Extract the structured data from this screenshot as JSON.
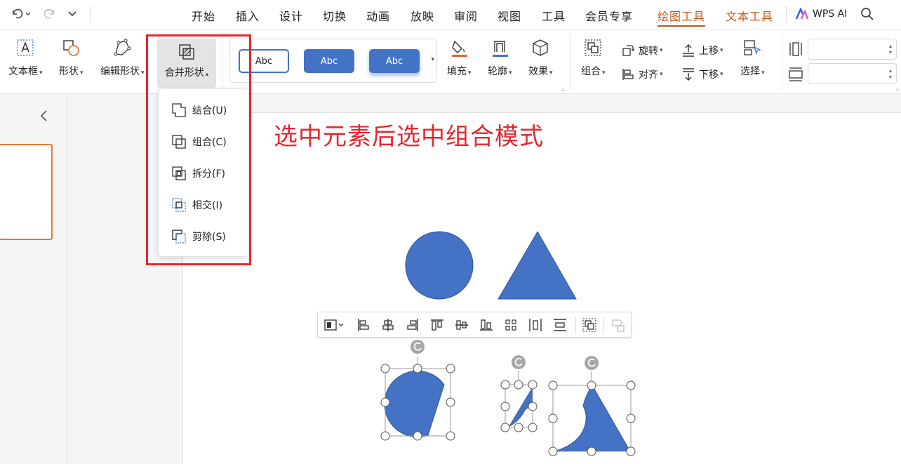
{
  "menu": {
    "items": [
      "开始",
      "插入",
      "设计",
      "切换",
      "动画",
      "放映",
      "审阅",
      "视图",
      "工具",
      "会员专享"
    ],
    "drawing_tools": "绘图工具",
    "text_tools": "文本工具",
    "ai": "WPS AI"
  },
  "ribbon": {
    "textbox": "文本框",
    "shape": "形状",
    "edit_shape": "编辑形状",
    "merge_shape": "合并形状",
    "styles": [
      "Abc",
      "Abc",
      "Abc"
    ],
    "fill": "填充",
    "outline": "轮廓",
    "effect": "效果",
    "group": "组合",
    "rotate": "旋转",
    "align": "对齐",
    "bring_forward": "上移",
    "send_backward": "下移",
    "select": "选择",
    "width_value": "",
    "height_value": ""
  },
  "dropdown": {
    "union": "结合(U)",
    "combine": "组合(C)",
    "fragment": "拆分(F)",
    "intersect": "相交(I)",
    "subtract": "剪除(S)"
  },
  "canvas": {
    "annotation": "选中元素后选中组合模式"
  },
  "colors": {
    "shape_blue": "#4472c4",
    "accent_orange": "#c0581a",
    "highlight_red": "#e8262d"
  }
}
